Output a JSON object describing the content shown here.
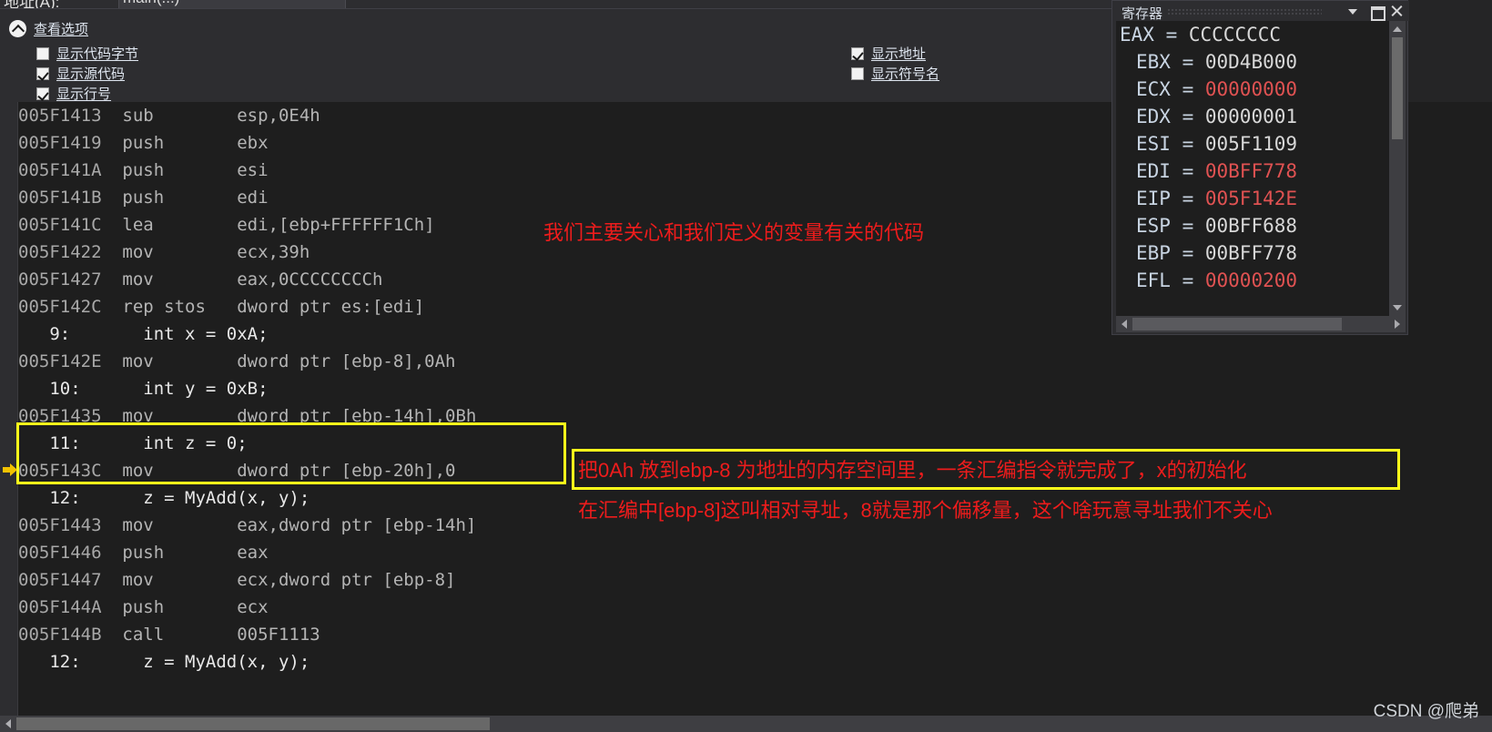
{
  "address_bar": {
    "label": "地址(A):",
    "value": "main(...)"
  },
  "view_options": {
    "header": "查看选项",
    "left_items": [
      {
        "label": "显示代码字节",
        "checked": false
      },
      {
        "label": "显示源代码",
        "checked": true
      },
      {
        "label": "显示行号",
        "checked": true
      }
    ],
    "right_items": [
      {
        "label": "显示地址",
        "checked": true
      },
      {
        "label": "显示符号名",
        "checked": false
      }
    ]
  },
  "disassembly": {
    "lines": [
      {
        "type": "asm",
        "addr": "005F1413",
        "mnemonic": "sub",
        "operands": "esp,0E4h"
      },
      {
        "type": "asm",
        "addr": "005F1419",
        "mnemonic": "push",
        "operands": "ebx"
      },
      {
        "type": "asm",
        "addr": "005F141A",
        "mnemonic": "push",
        "operands": "esi"
      },
      {
        "type": "asm",
        "addr": "005F141B",
        "mnemonic": "push",
        "operands": "edi"
      },
      {
        "type": "asm",
        "addr": "005F141C",
        "mnemonic": "lea",
        "operands": "edi,[ebp+FFFFFF1Ch]"
      },
      {
        "type": "asm",
        "addr": "005F1422",
        "mnemonic": "mov",
        "operands": "ecx,39h"
      },
      {
        "type": "asm",
        "addr": "005F1427",
        "mnemonic": "mov",
        "operands": "eax,0CCCCCCCCh"
      },
      {
        "type": "asm",
        "addr": "005F142C",
        "mnemonic": "rep stos",
        "operands": "dword ptr es:[edi]"
      },
      {
        "type": "source",
        "lineno": "9:",
        "source": "int x = 0xA;"
      },
      {
        "type": "asm",
        "addr": "005F142E",
        "mnemonic": "mov",
        "operands": "dword ptr [ebp-8],0Ah",
        "current": true
      },
      {
        "type": "source",
        "lineno": "10:",
        "source": "int y = 0xB;"
      },
      {
        "type": "asm",
        "addr": "005F1435",
        "mnemonic": "mov",
        "operands": "dword ptr [ebp-14h],0Bh"
      },
      {
        "type": "source",
        "lineno": "11:",
        "source": "int z = 0;"
      },
      {
        "type": "asm",
        "addr": "005F143C",
        "mnemonic": "mov",
        "operands": "dword ptr [ebp-20h],0"
      },
      {
        "type": "source",
        "lineno": "12:",
        "source": "z = MyAdd(x, y);"
      },
      {
        "type": "asm",
        "addr": "005F1443",
        "mnemonic": "mov",
        "operands": "eax,dword ptr [ebp-14h]"
      },
      {
        "type": "asm",
        "addr": "005F1446",
        "mnemonic": "push",
        "operands": "eax"
      },
      {
        "type": "asm",
        "addr": "005F1447",
        "mnemonic": "mov",
        "operands": "ecx,dword ptr [ebp-8]"
      },
      {
        "type": "asm",
        "addr": "005F144A",
        "mnemonic": "push",
        "operands": "ecx"
      },
      {
        "type": "asm",
        "addr": "005F144B",
        "mnemonic": "call",
        "operands": "005F1113"
      },
      {
        "type": "source",
        "lineno": "12:",
        "source": "z = MyAdd(x, y);"
      }
    ]
  },
  "annotations": {
    "top": "我们主要关心和我们定义的变量有关的代码",
    "note_line1": "把0Ah 放到ebp-8 为地址的内存空间里，一条汇编指令就完成了，x的初始化",
    "note_line2": "在汇编中[ebp-8]这叫相对寻址，8就是那个偏移量，这个啥玩意寻址我们不关心",
    "highlight_color": "#ffff1a",
    "text_color": "#ee1c1c"
  },
  "registers_window": {
    "title": "寄存器",
    "registers": [
      {
        "name": "EAX",
        "value": "CCCCCCCC",
        "changed": false
      },
      {
        "name": "EBX",
        "value": "00D4B000",
        "changed": false
      },
      {
        "name": "ECX",
        "value": "00000000",
        "changed": true
      },
      {
        "name": "EDX",
        "value": "00000001",
        "changed": false
      },
      {
        "name": "ESI",
        "value": "005F1109",
        "changed": false
      },
      {
        "name": "EDI",
        "value": "00BFF778",
        "changed": true
      },
      {
        "name": "EIP",
        "value": "005F142E",
        "changed": true
      },
      {
        "name": "ESP",
        "value": "00BFF688",
        "changed": false
      },
      {
        "name": "EBP",
        "value": "00BFF778",
        "changed": false
      },
      {
        "name": "EFL",
        "value": "00000200",
        "changed": true
      }
    ],
    "changed_color": "#e05252"
  },
  "watermark": "CSDN @爬弟"
}
